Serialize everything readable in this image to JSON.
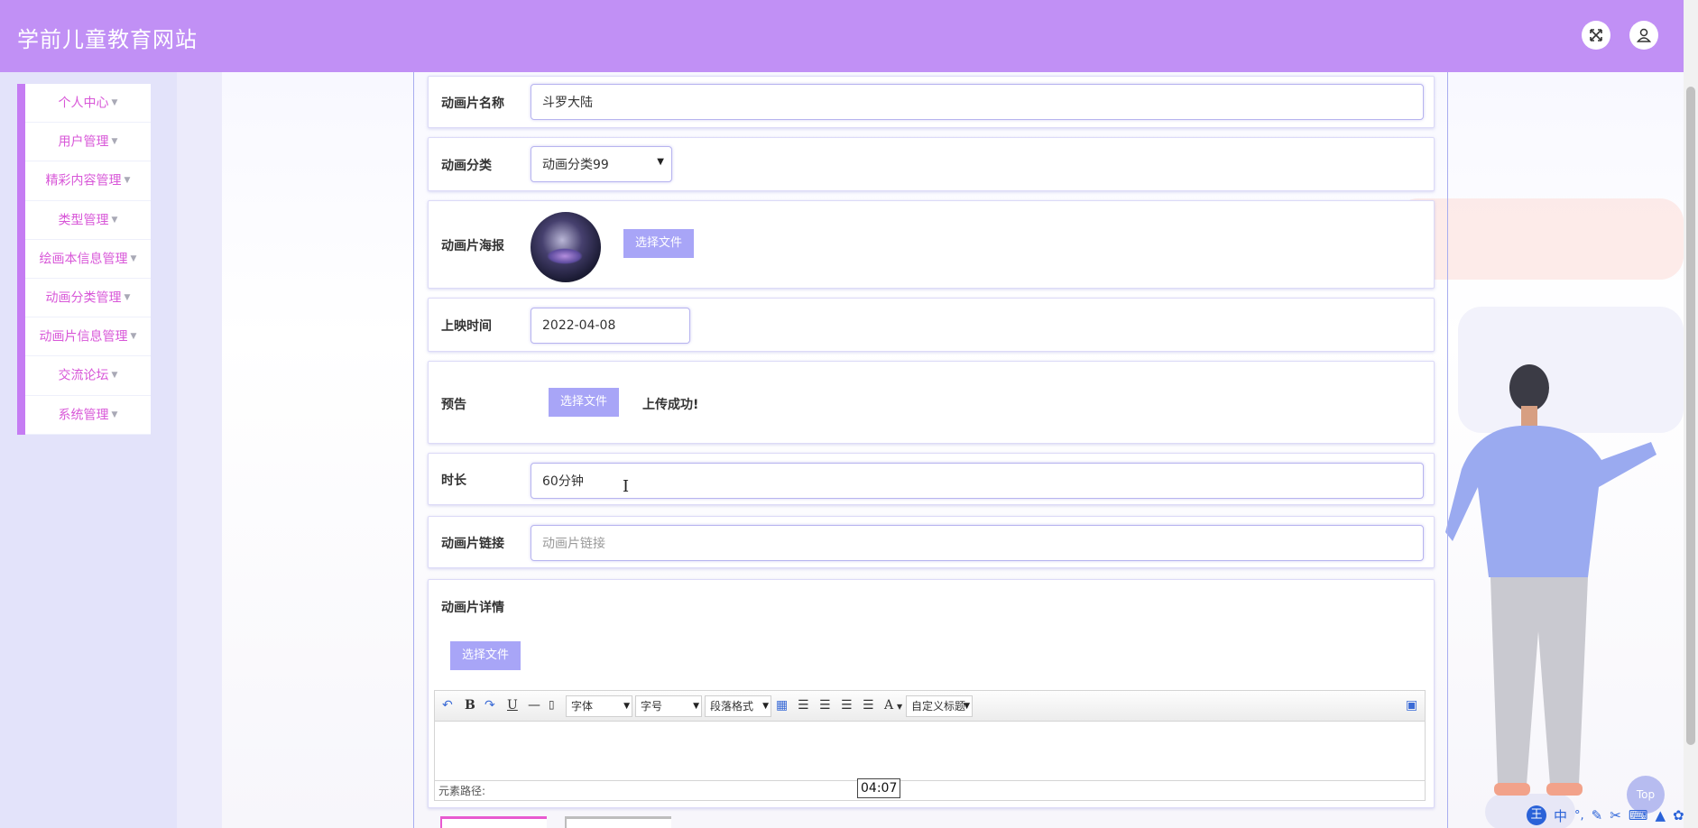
{
  "header": {
    "site_title": "学前儿童教育网站"
  },
  "sidebar": {
    "items": [
      {
        "label": "个人中心"
      },
      {
        "label": "用户管理"
      },
      {
        "label": "精彩内容管理"
      },
      {
        "label": "类型管理"
      },
      {
        "label": "绘画本信息管理"
      },
      {
        "label": "动画分类管理"
      },
      {
        "label": "动画片信息管理"
      },
      {
        "label": "交流论坛"
      },
      {
        "label": "系统管理"
      }
    ]
  },
  "form": {
    "name": {
      "label": "动画片名称",
      "value": "斗罗大陆"
    },
    "category": {
      "label": "动画分类",
      "value": "动画分类99"
    },
    "poster": {
      "label": "动画片海报",
      "button": "选择文件"
    },
    "release": {
      "label": "上映时间",
      "value": "2022-04-08"
    },
    "trailer": {
      "label": "预告",
      "button": "选择文件",
      "status": "上传成功!"
    },
    "duration": {
      "label": "时长",
      "value": "60分钟"
    },
    "link": {
      "label": "动画片链接",
      "placeholder": "动画片链接"
    },
    "detail": {
      "label": "动画片详情",
      "button": "选择文件",
      "toolbar": {
        "font": "字体",
        "size": "字号",
        "paragraph": "段落格式",
        "custom": "自定义标题",
        "bold": "B",
        "underline": "U",
        "font_color": "A"
      },
      "footer": "元素路径:"
    }
  },
  "overlay": {
    "time_tooltip": "04:07",
    "top_button": "Top",
    "ime": {
      "logo": "王",
      "lang": "中",
      "punct": "°,"
    }
  },
  "colors": {
    "header": "#c190f5",
    "sidebar_accent": "#c57cf3",
    "sidebar_text": "#d857d8",
    "button": "#a8a5f7"
  }
}
